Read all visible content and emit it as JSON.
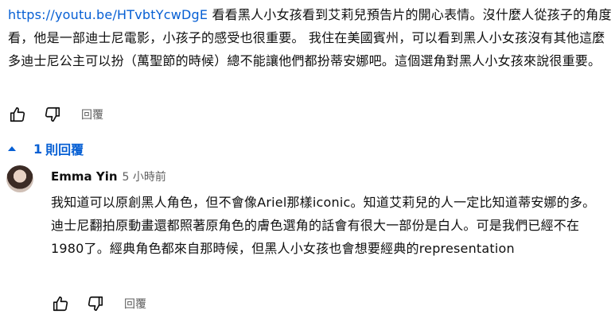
{
  "comment": {
    "link": "https://youtu.be/HTvbtYcwDgE",
    "text": " 看看黑人小女孩看到艾莉兒預告片的開心表情。沒什麼人從孩子的角度看，他是一部迪士尼電影，小孩子的感受也很重要。 我住在美國賓州，可以看到黑人小女孩沒有其他這麼多迪士尼公主可以扮（萬聖節的時候）總不能讓他們都扮蒂安娜吧。這個選角對黑人小女孩來說很重要。",
    "reply_label": "回覆"
  },
  "replies_toggle": {
    "count": "1",
    "label": "則回覆"
  },
  "reply": {
    "author": "Emma Yin",
    "time": "5 小時前",
    "text": "我知道可以原創黑人角色，但不會像Ariel那樣iconic。知道艾莉兒的人一定比知道蒂安娜的多。 迪士尼翻拍原動畫還都照著原角色的膚色選角的話會有很大一部份是白人。可是我們已經不在1980了。經典角色都來自那時候，但黑人小女孩也會想要經典的representation",
    "reply_label": "回覆"
  },
  "icons": [
    "thumb-up-icon",
    "thumb-down-icon",
    "caret-up-icon"
  ],
  "colors": {
    "link": "#065fd4",
    "muted": "#606060",
    "text": "#0f0f0f"
  }
}
